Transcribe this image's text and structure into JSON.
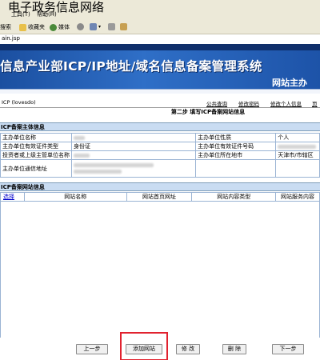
{
  "overlay_title": "电子政务信息网络",
  "browser": {
    "menu": {
      "tools": "工具(T)",
      "help": "帮助(H)"
    },
    "toolbar": {
      "search": "搜索",
      "favorites": "收藏夹",
      "media": "媒体"
    },
    "address": "ain.jsp"
  },
  "banner": {
    "title": "信息产业部ICP/IP地址/域名信息备案管理系统",
    "subtitle": "网站主办"
  },
  "infobar": {
    "user": "ICP (lovesdo)",
    "links": [
      "公共查询",
      "修改密码",
      "修改个人信息",
      "页"
    ]
  },
  "step_title": "第二步 填写ICP备案网站信息",
  "section_main": "ICP备案主体信息",
  "info_rows": {
    "r1": {
      "l1": "主办单位名称",
      "l2": "主办单位性质",
      "v2": "个人"
    },
    "r2": {
      "l1": "主办单位有效证件类型",
      "v1": "身份证",
      "l2": "主办单位有效证件号码"
    },
    "r3": {
      "l1": "投资者或上级主管单位名称",
      "l2": "主办单位所在地市",
      "v2": "天津市/市辖区"
    },
    "r4": {
      "l1": "主办单位通信地址"
    }
  },
  "section_site": "ICP备案网站信息",
  "site_headers": [
    "选择",
    "网站名称",
    "网站首页网址",
    "网站内容类型",
    "网站服务内容"
  ],
  "buttons": {
    "prev": "上一步",
    "add_site": "添加网站",
    "modify": "修 改",
    "delete": "删 除",
    "next": "下一步"
  },
  "colors": {
    "highlight": "#e1222f",
    "banner": "#2f6fc7",
    "section_bg": "#c9dcf2"
  }
}
